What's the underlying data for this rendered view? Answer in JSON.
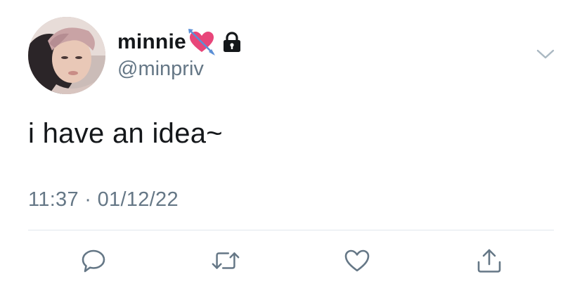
{
  "tweet": {
    "author": {
      "display_name": "minnie",
      "handle": "@minpriv",
      "emoji_icon": "heart-with-arrow-icon",
      "protected_icon": "lock-icon"
    },
    "text": "i have an idea~",
    "timestamp": "11:37 · 01/12/22"
  },
  "actions": [
    {
      "name": "reply",
      "icon": "reply-bubble-icon"
    },
    {
      "name": "retweet",
      "icon": "retweet-icon"
    },
    {
      "name": "like",
      "icon": "heart-outline-icon"
    },
    {
      "name": "share",
      "icon": "share-icon"
    }
  ],
  "menu_icon": "chevron-down-icon",
  "colors": {
    "primary_text": "#14171a",
    "secondary_text": "#657786",
    "divider": "#e1e8ed",
    "icon": "#657786",
    "emoji_heart": "#e8467a"
  }
}
